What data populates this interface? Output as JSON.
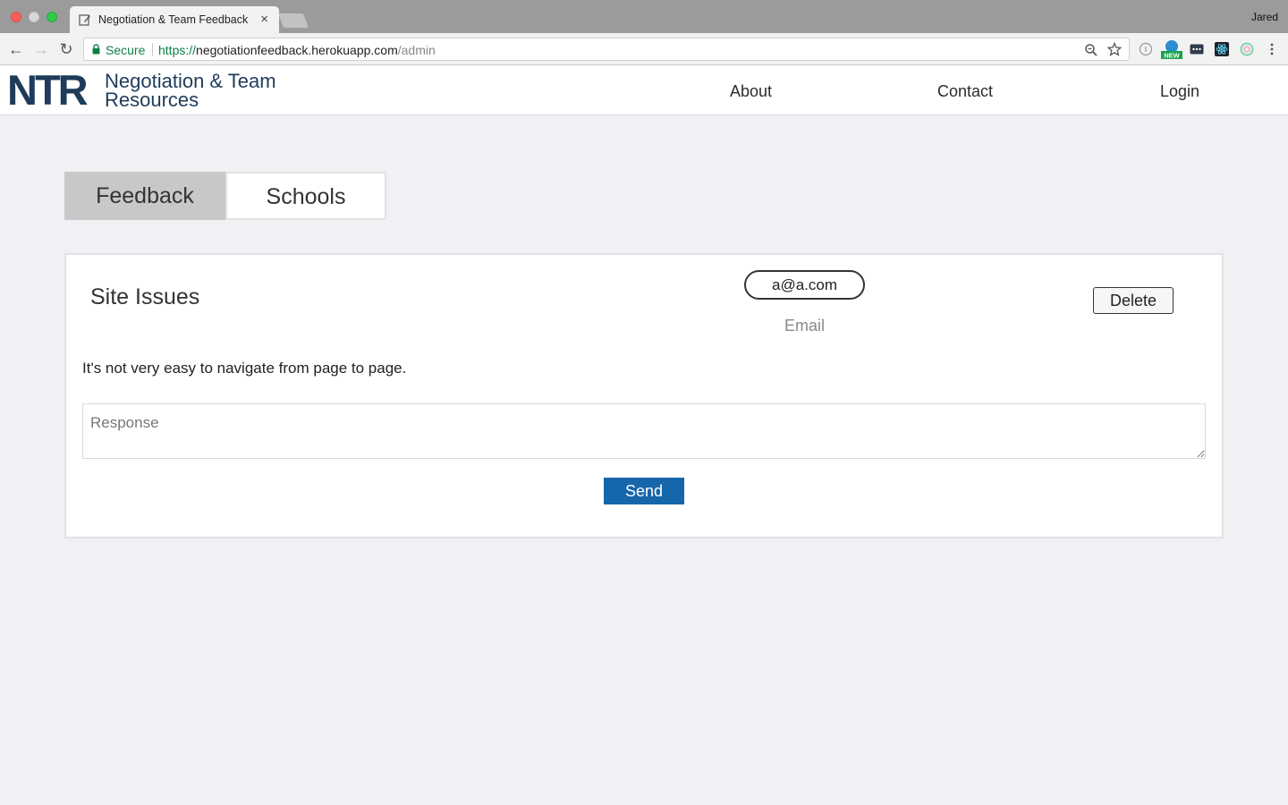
{
  "browser": {
    "tab_title": "Negotiation & Team Feedback",
    "tab_close": "×",
    "profile_name": "Jared",
    "secure_label": "Secure",
    "url_scheme": "https://",
    "url_host": "negotiationfeedback.herokuapp.com",
    "url_path": "/admin",
    "back_glyph": "←",
    "forward_glyph": "→",
    "reload_glyph": "↻"
  },
  "site": {
    "logo_mark": "NTR",
    "logo_line1": "Negotiation & Team",
    "logo_line2": "Resources",
    "nav": {
      "about": "About",
      "contact": "Contact",
      "login": "Login"
    }
  },
  "admin": {
    "tabs": {
      "feedback": "Feedback",
      "schools": "Schools"
    },
    "feedback_item": {
      "title": "Site Issues",
      "email": "a@a.com",
      "email_label": "Email",
      "delete_label": "Delete",
      "message": "It's not very easy to navigate from page to page.",
      "response_placeholder": "Response",
      "send_label": "Send"
    }
  },
  "colors": {
    "brand_navy": "#1e3c5a",
    "send_blue": "#1666ab",
    "active_tab": "#c8c8c8",
    "page_bg": "#f0f1f4"
  }
}
